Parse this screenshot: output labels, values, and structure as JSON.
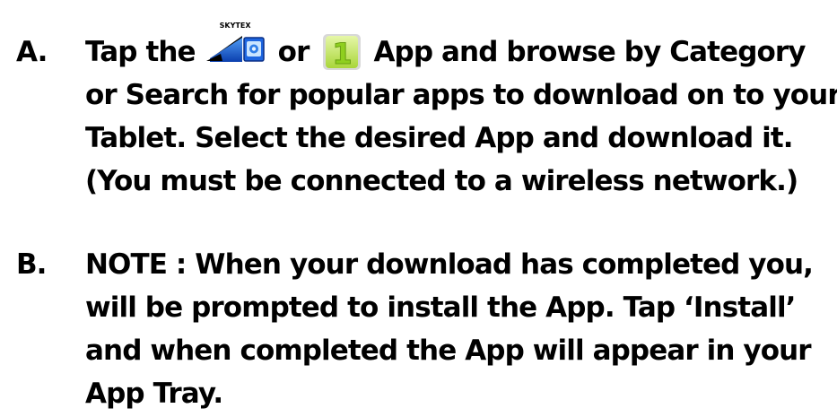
{
  "item_a": {
    "marker": "A.",
    "line1_before": "Tap the",
    "line1_middle": "or",
    "line1_after": "App and browse by Category",
    "line2": "or Search for popular apps to download on to your",
    "line3": "Tablet. Select the desired App and download it.",
    "line4": "(You must be connected to a wireless network.)",
    "store_icon_label": "SKYTEX",
    "store_icon": "skytex-app-store-icon",
    "one_icon": "one-market-app-icon",
    "one_icon_glyph": "1"
  },
  "item_b": {
    "marker": "B.",
    "line1": "NOTE : When your download has completed you,",
    "line2": "will be prompted to install the App. Tap ‘Install’",
    "line3": "and when completed the App will appear in your",
    "line4": "App Tray."
  },
  "colors": {
    "text": "#000000",
    "background": "#ffffff",
    "store_icon_blue": "#1b5fd6",
    "one_icon_green": "#c5e85a"
  }
}
